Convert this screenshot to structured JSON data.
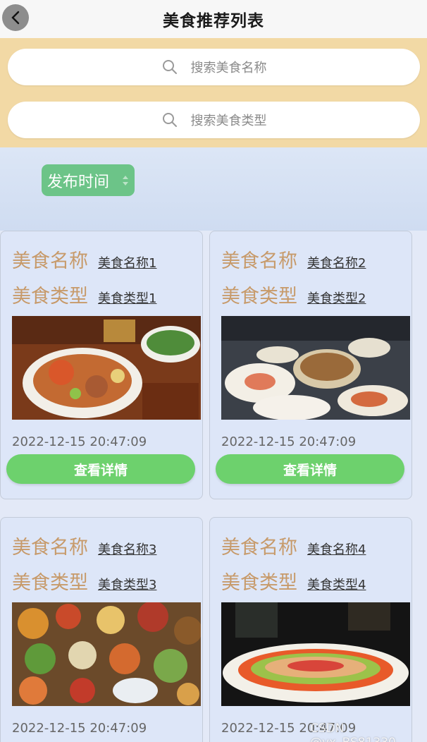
{
  "header": {
    "title": "美食推荐列表",
    "back_icon": "chevron-left-icon"
  },
  "search": {
    "name_placeholder": "搜索美食名称",
    "type_placeholder": "搜索美食类型"
  },
  "sort": {
    "label": "发布时间"
  },
  "card_labels": {
    "name_key": "美食名称",
    "type_key": "美食类型",
    "detail_button": "查看详情"
  },
  "items": [
    {
      "name": "美食名称1",
      "type": "美食类型1",
      "date": "2022-12-15 20:47:09",
      "image": "crab-platter"
    },
    {
      "name": "美食名称2",
      "type": "美食类型2",
      "date": "2022-12-15 20:47:09",
      "image": "banquet-table"
    },
    {
      "name": "美食名称3",
      "type": "美食类型3",
      "date": "2022-12-15 20:47:09",
      "image": "buffet-spread"
    },
    {
      "name": "美食名称4",
      "type": "美食类型4",
      "date": "2022-12-15 20:47:09",
      "image": "salad-plate"
    }
  ],
  "watermark": "CSDN @vx_BS81330",
  "colors": {
    "search_bg": "#f2d9a5",
    "sort_button": "#6cc488",
    "detail_button": "#6dd16d",
    "key_text": "#c79a6a"
  }
}
